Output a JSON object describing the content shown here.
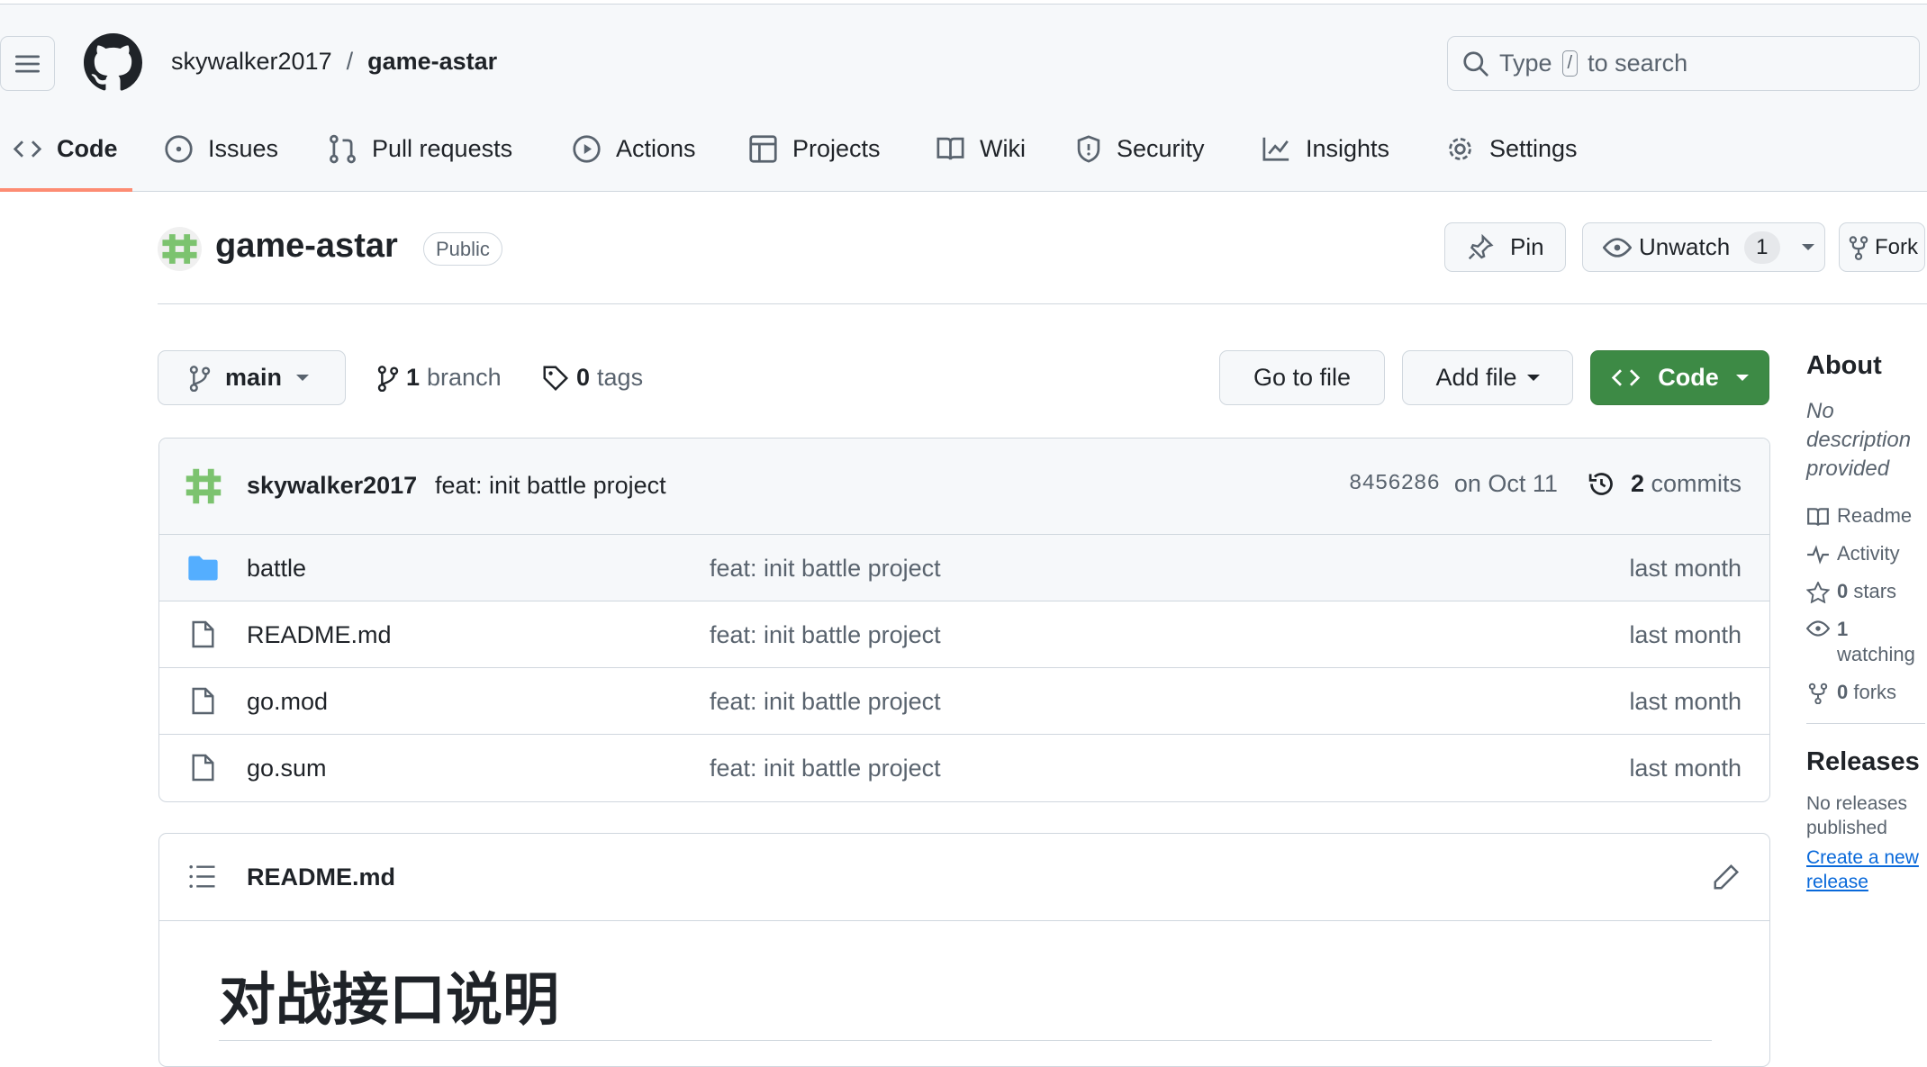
{
  "header": {
    "owner": "skywalker2017",
    "separator": "/",
    "repo": "game-astar",
    "search_prefix": "Type",
    "search_key": "/",
    "search_suffix": "to search"
  },
  "tabs": [
    {
      "label": "Code",
      "icon": "code-icon"
    },
    {
      "label": "Issues",
      "icon": "issue-icon"
    },
    {
      "label": "Pull requests",
      "icon": "pull-request-icon"
    },
    {
      "label": "Actions",
      "icon": "play-icon"
    },
    {
      "label": "Projects",
      "icon": "table-icon"
    },
    {
      "label": "Wiki",
      "icon": "book-icon"
    },
    {
      "label": "Security",
      "icon": "shield-icon"
    },
    {
      "label": "Insights",
      "icon": "graph-icon"
    },
    {
      "label": "Settings",
      "icon": "gear-icon"
    }
  ],
  "repo": {
    "name": "game-astar",
    "visibility": "Public",
    "pin": "Pin",
    "unwatch": "Unwatch",
    "watch_count": "1",
    "fork": "Fork"
  },
  "toolbar": {
    "branch": "main",
    "branch_count": "1",
    "branch_label": "branch",
    "tag_count": "0",
    "tag_label": "tags",
    "go_to_file": "Go to file",
    "add_file": "Add file",
    "code": "Code"
  },
  "commit": {
    "author": "skywalker2017",
    "message": "feat: init battle project",
    "sha": "8456286",
    "date": "on Oct 11",
    "count": "2",
    "count_label": "commits"
  },
  "files": [
    {
      "type": "folder",
      "name": "battle",
      "message": "feat: init battle project",
      "date": "last month"
    },
    {
      "type": "file",
      "name": "README.md",
      "message": "feat: init battle project",
      "date": "last month"
    },
    {
      "type": "file",
      "name": "go.mod",
      "message": "feat: init battle project",
      "date": "last month"
    },
    {
      "type": "file",
      "name": "go.sum",
      "message": "feat: init battle project",
      "date": "last month"
    }
  ],
  "readme": {
    "filename": "README.md",
    "heading": "对战接口说明"
  },
  "about": {
    "title": "About",
    "description": "No description provided",
    "readme": "Readme",
    "activity": "Activity",
    "stars_count": "0",
    "stars": "stars",
    "watching_count": "1",
    "watching": "watching",
    "forks_count": "0",
    "forks": "forks"
  },
  "releases": {
    "title": "Releases",
    "none": "No releases published",
    "create": "Create a new release"
  },
  "colors": {
    "accent_underline": "#fd8c73",
    "code_button": "#3d8a45",
    "link": "#0969da",
    "folder": "#54aeff"
  }
}
